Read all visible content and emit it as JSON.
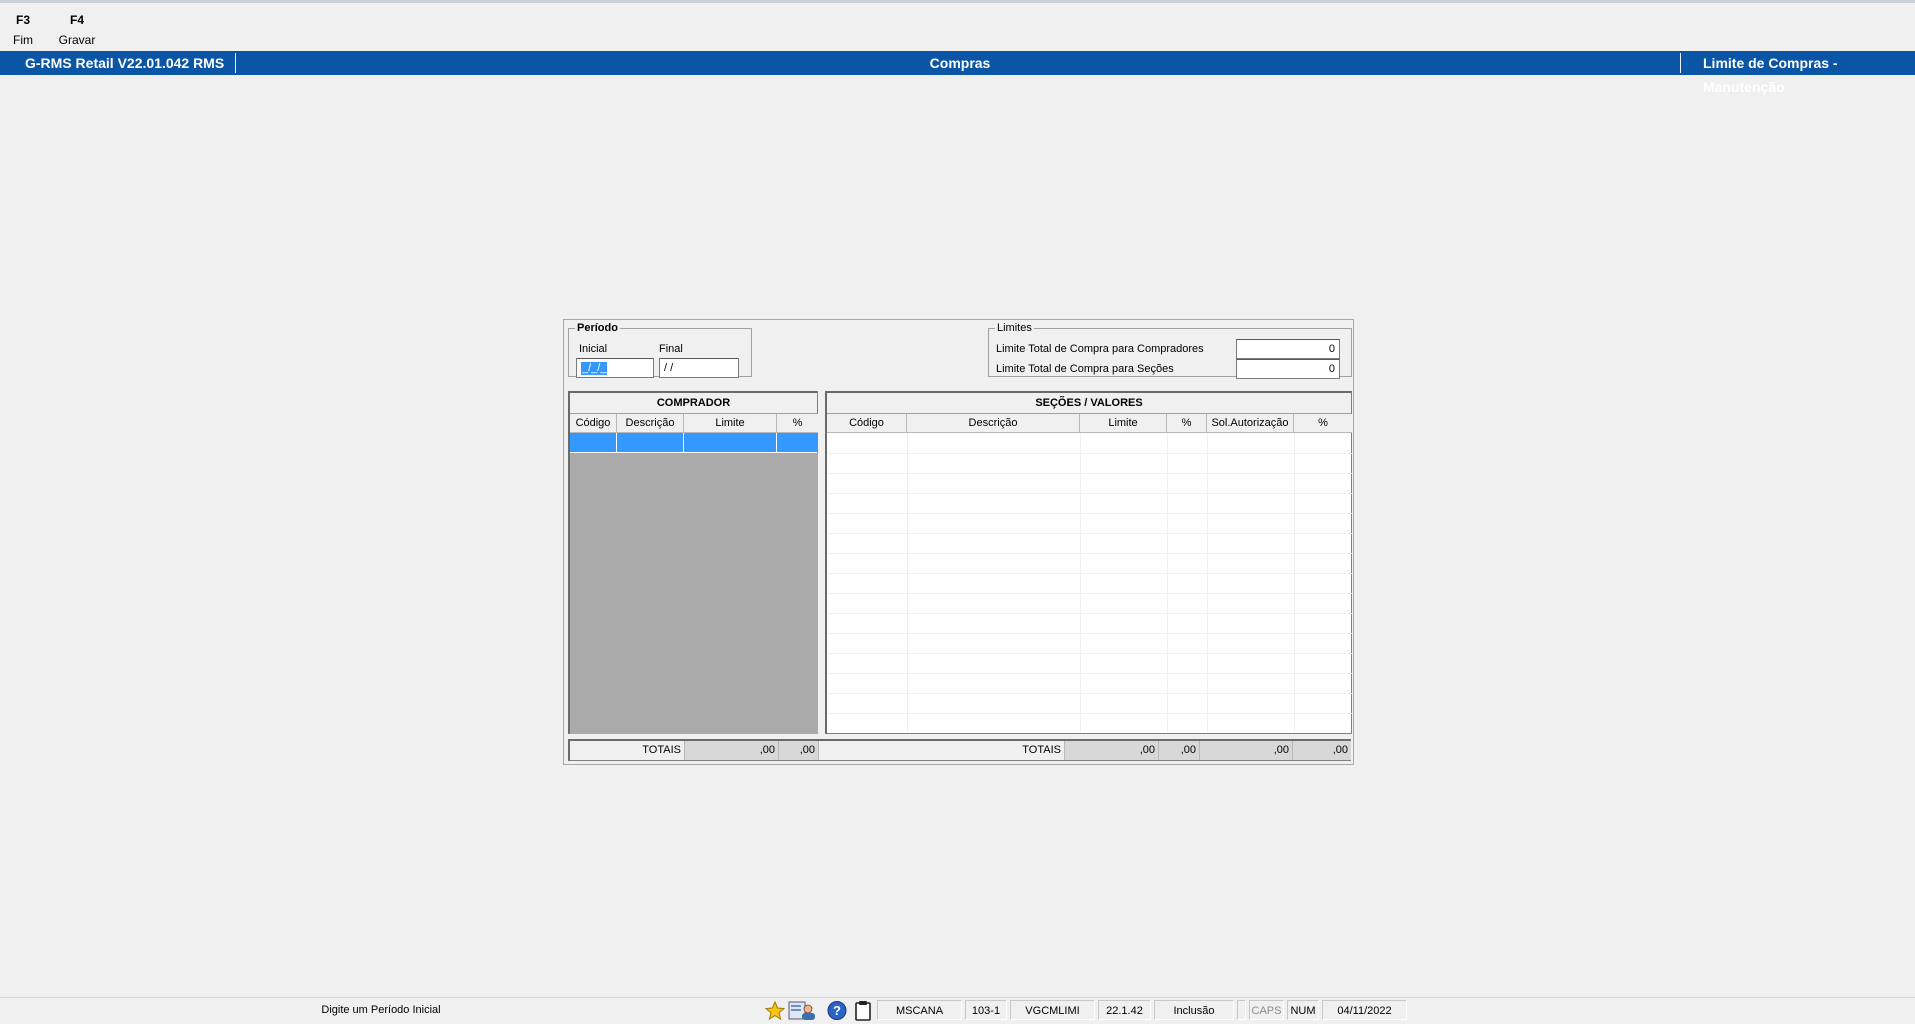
{
  "function_keys": [
    {
      "key": "F3",
      "label": "Fim"
    },
    {
      "key": "F4",
      "label": "Gravar"
    }
  ],
  "titlebar": {
    "app": "G-RMS Retail V22.01.042 RMS",
    "module": "Compras",
    "screen": "Limite de Compras - Manutenção"
  },
  "periodo": {
    "legend": "Período",
    "inicial_label": "Inicial",
    "inicial_value": "_/_/_",
    "final_label": "Final",
    "final_value": " /  /"
  },
  "limites": {
    "legend": "Limites",
    "compradores_label": "Limite Total de Compra para Compradores",
    "compradores_value": "0",
    "secoes_label": "Limite Total de Compra para Seções",
    "secoes_value": "0"
  },
  "comprador_grid": {
    "title": "COMPRADOR",
    "columns": [
      "Código",
      "Descrição",
      "Limite",
      "%"
    ]
  },
  "secoes_grid": {
    "title": "SEÇÕES / VALORES",
    "columns": [
      "Código",
      "Descrição",
      "Limite",
      "%",
      "Sol.Autorização",
      "%"
    ]
  },
  "totals": {
    "label_left": "TOTAIS",
    "left_limite": ",00",
    "left_pct": ",00",
    "label_right": "TOTAIS",
    "right_limite": ",00",
    "right_pct": ",00",
    "right_sol": ",00",
    "right_pct2": ",00"
  },
  "statusbar": {
    "message": "Digite um Período Inicial",
    "icons": [
      "star-icon",
      "users-icon",
      "help-icon",
      "clipboard-icon"
    ],
    "user": "MSCANA",
    "company": "103-1",
    "program": "VGCMLIMI",
    "version": "22.1.42",
    "mode": "Inclusão",
    "caps": "CAPS",
    "num": "NUM",
    "date": "04/11/2022"
  }
}
